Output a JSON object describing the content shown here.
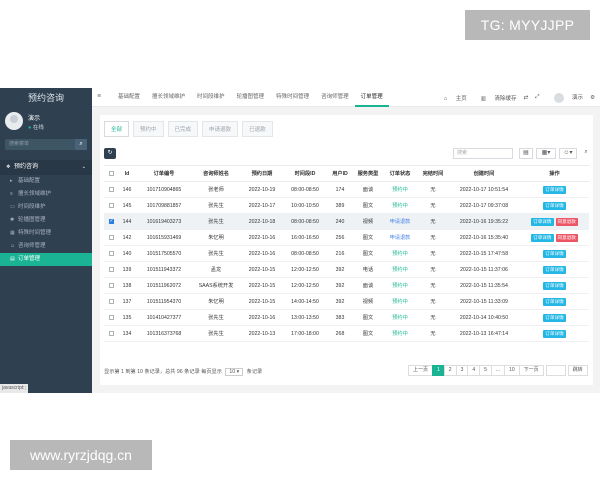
{
  "watermarks": {
    "top": "TG: MYYJJPP",
    "bottom": "www.ryrzjdqg.cn"
  },
  "sidebar": {
    "title": "预约咨询",
    "user_name": "演示",
    "status": "在线",
    "search_placeholder": "搜索菜单",
    "parent_label": "预约咨询",
    "items": [
      {
        "label": "基础配置",
        "icon": "sliders-icon"
      },
      {
        "label": "擅长领域维护",
        "icon": "list-icon"
      },
      {
        "label": "时间段维护",
        "icon": "image-icon"
      },
      {
        "label": "轮播图管理",
        "icon": "gear-icon"
      },
      {
        "label": "特殊时间管理",
        "icon": "calendar-icon"
      },
      {
        "label": "咨询师管理",
        "icon": "user-icon"
      },
      {
        "label": "订单管理",
        "icon": "file-icon"
      }
    ],
    "footer": "javascript:;"
  },
  "topbar": {
    "tabs": [
      "基础配置",
      "擅长领域维护",
      "时间段维护",
      "轮播图管理",
      "特殊时间管理",
      "咨询师管理",
      "订单管理"
    ],
    "home": "主页",
    "clear_cache": "清除缓存",
    "user": "演示"
  },
  "subtabs": [
    "全部",
    "预约中",
    "已完成",
    "申请退款",
    "已退款"
  ],
  "toolbar": {
    "search_placeholder": "搜索"
  },
  "table": {
    "headers": [
      "Id",
      "订单编号",
      "咨询师姓名",
      "预约日期",
      "时间段ID",
      "用户ID",
      "服务类型",
      "订单状态",
      "完结时间",
      "创建时间",
      "操作"
    ],
    "rows": [
      {
        "id": "146",
        "no": "101710904865",
        "name": "张老师",
        "date": "2022-10-19",
        "slot": "08:00-08:50",
        "uid": "174",
        "type": "面谈",
        "status": "预约中",
        "finish": "无",
        "created": "2022-10-17 10:51:54",
        "selected": false,
        "refund": false
      },
      {
        "id": "145",
        "no": "101709881857",
        "name": "张先生",
        "date": "2022-10-17",
        "slot": "10:00-10:50",
        "uid": "389",
        "type": "图文",
        "status": "预约中",
        "finish": "无",
        "created": "2022-10-17 09:37:08",
        "selected": false,
        "refund": false
      },
      {
        "id": "144",
        "no": "101619403273",
        "name": "张先生",
        "date": "2022-10-18",
        "slot": "08:00-08:50",
        "uid": "240",
        "type": "视频",
        "status": "申请退款",
        "finish": "无",
        "created": "2022-10-16 19:35:22",
        "selected": true,
        "refund": true
      },
      {
        "id": "142",
        "no": "101615931469",
        "name": "朱忆明",
        "date": "2022-10-16",
        "slot": "16:00-16:50",
        "uid": "256",
        "type": "图文",
        "status": "申请退款",
        "finish": "无",
        "created": "2022-10-16 15:35:40",
        "selected": false,
        "refund": true
      },
      {
        "id": "140",
        "no": "101517505570",
        "name": "张先生",
        "date": "2022-10-16",
        "slot": "08:00-08:50",
        "uid": "216",
        "type": "图文",
        "status": "预约中",
        "finish": "无",
        "created": "2022-10-15 17:47:58",
        "selected": false,
        "refund": false
      },
      {
        "id": "139",
        "no": "101511943372",
        "name": "孟龙",
        "date": "2022-10-15",
        "slot": "12:00-12:50",
        "uid": "392",
        "type": "电话",
        "status": "预约中",
        "finish": "无",
        "created": "2022-10-15 11:37:06",
        "selected": false,
        "refund": false
      },
      {
        "id": "138",
        "no": "101511962072",
        "name": "SAAS系统开发",
        "date": "2022-10-15",
        "slot": "12:00-12:50",
        "uid": "392",
        "type": "面谈",
        "status": "预约中",
        "finish": "无",
        "created": "2022-10-15 11:35:54",
        "selected": false,
        "refund": false
      },
      {
        "id": "137",
        "no": "101511954370",
        "name": "朱忆明",
        "date": "2022-10-15",
        "slot": "14:00-14:50",
        "uid": "392",
        "type": "视频",
        "status": "预约中",
        "finish": "无",
        "created": "2022-10-15 11:33:09",
        "selected": false,
        "refund": false
      },
      {
        "id": "135",
        "no": "101410427377",
        "name": "张先生",
        "date": "2022-10-16",
        "slot": "13:00-13:50",
        "uid": "383",
        "type": "图文",
        "status": "预约中",
        "finish": "无",
        "created": "2022-10-14 10:40:50",
        "selected": false,
        "refund": false
      },
      {
        "id": "134",
        "no": "101316373768",
        "name": "张先生",
        "date": "2022-10-13",
        "slot": "17:00-18:00",
        "uid": "268",
        "type": "图文",
        "status": "预约中",
        "finish": "无",
        "created": "2022-10-13 16:47:14",
        "selected": false,
        "refund": false
      }
    ],
    "detail_label": "订单详情",
    "refund_label": "同意退款"
  },
  "footer": {
    "info_prefix": "显示第 1 到第 10 条记录，总共 96 条记录 每页显示",
    "page_size": "10",
    "info_suffix": "条记录",
    "prev": "上一页",
    "pages": [
      "1",
      "2",
      "3",
      "4",
      "5",
      "...",
      "10"
    ],
    "next": "下一页",
    "go": "跳转"
  },
  "colors": {
    "sidebar": "#2f4050",
    "accent": "#1ab394",
    "refund": "#ed5565",
    "detail": "#23b7e5"
  }
}
